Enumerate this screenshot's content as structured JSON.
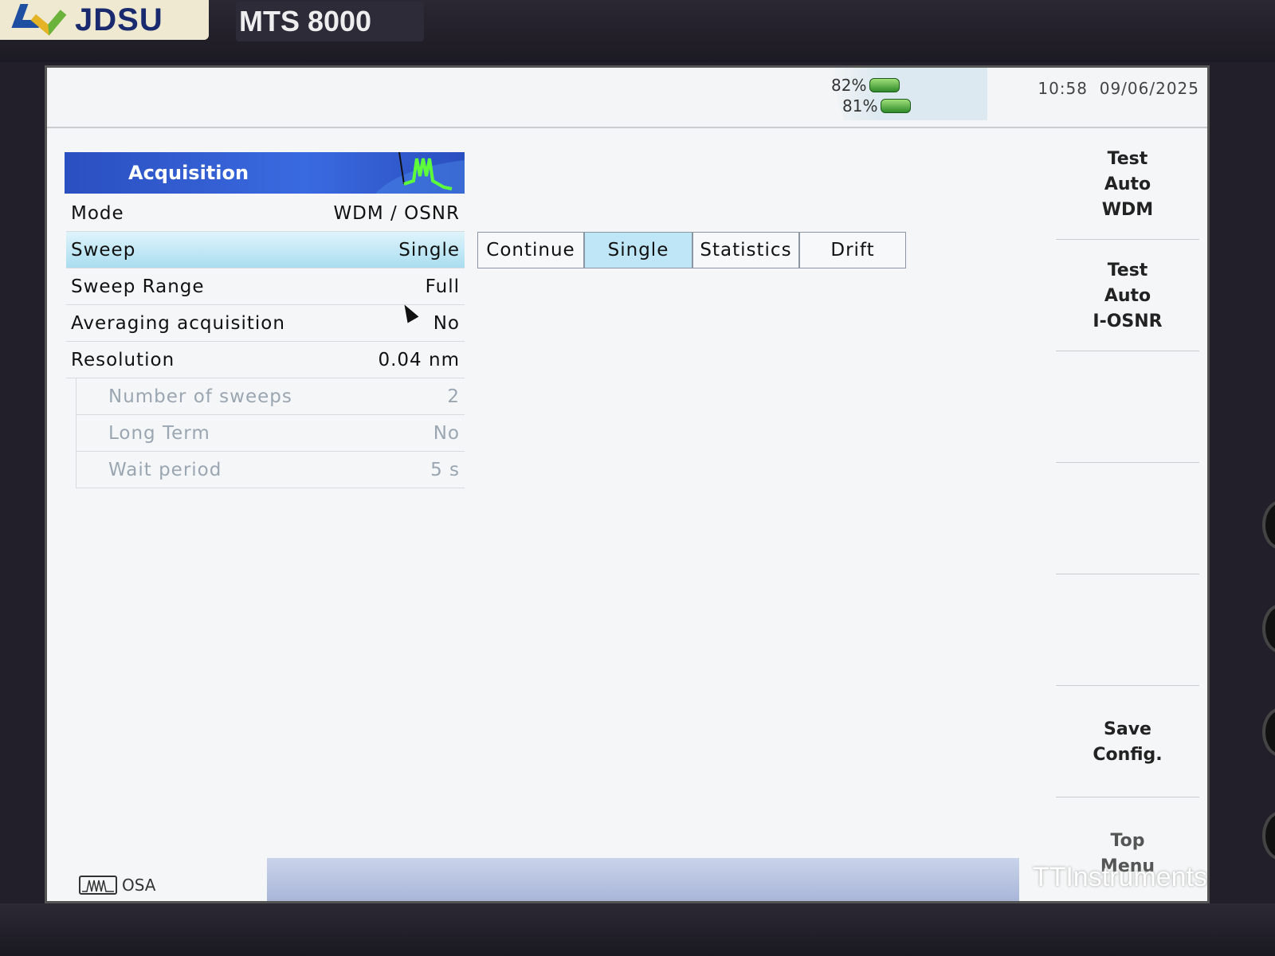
{
  "device": {
    "brand": "JDSU",
    "model": "MTS 8000"
  },
  "status": {
    "battery1": "82%",
    "battery2": "81%",
    "time": "10:58",
    "date": "09/06/2025"
  },
  "acquisition": {
    "title": "Acquisition",
    "rows": [
      {
        "label": "Mode",
        "value": "WDM / OSNR"
      },
      {
        "label": "Sweep",
        "value": "Single"
      },
      {
        "label": "Sweep Range",
        "value": "Full"
      },
      {
        "label": "Averaging acquisition",
        "value": "No"
      },
      {
        "label": "Resolution",
        "value": "0.04 nm"
      },
      {
        "label": "Number of sweeps",
        "value": "2"
      },
      {
        "label": "Long Term",
        "value": "No"
      },
      {
        "label": "Wait period",
        "value": "5 s"
      }
    ]
  },
  "sweep_options": [
    "Continue",
    "Single",
    "Statistics",
    "Drift"
  ],
  "softkeys": {
    "k1": "Test\nAuto\nWDM",
    "k2": "Test\nAuto\nI-OSNR",
    "k3": "Save\nConfig.",
    "k4": "Top\nMenu"
  },
  "bottom": {
    "tab": "OSA",
    "watermark": "TTInstruments"
  }
}
